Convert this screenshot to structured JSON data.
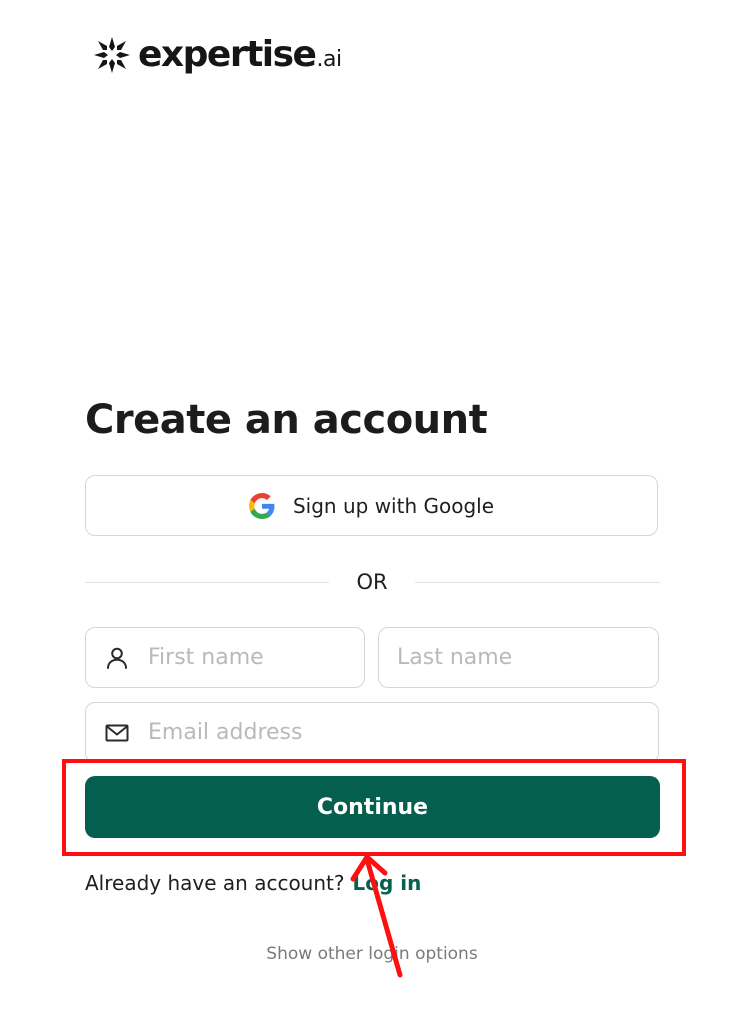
{
  "brand": {
    "name": "expertise",
    "suffix": ".ai",
    "logo_icon": "asterisk-burst-logo-icon"
  },
  "page": {
    "title": "Create an account"
  },
  "google_signup": {
    "label": "Sign up with Google",
    "icon": "google-icon"
  },
  "divider": {
    "text": "OR"
  },
  "form": {
    "first_name": {
      "placeholder": "First name",
      "value": "",
      "icon": "person-icon"
    },
    "last_name": {
      "placeholder": "Last name",
      "value": ""
    },
    "email": {
      "placeholder": "Email address",
      "value": "",
      "icon": "mail-icon"
    },
    "continue_label": "Continue"
  },
  "login_prompt": {
    "text": "Already have an account?",
    "link": "Log in"
  },
  "other_options": "Show other login options",
  "colors": {
    "primary": "#055f4e",
    "link": "#07614f",
    "annotation": "#ff1010"
  }
}
